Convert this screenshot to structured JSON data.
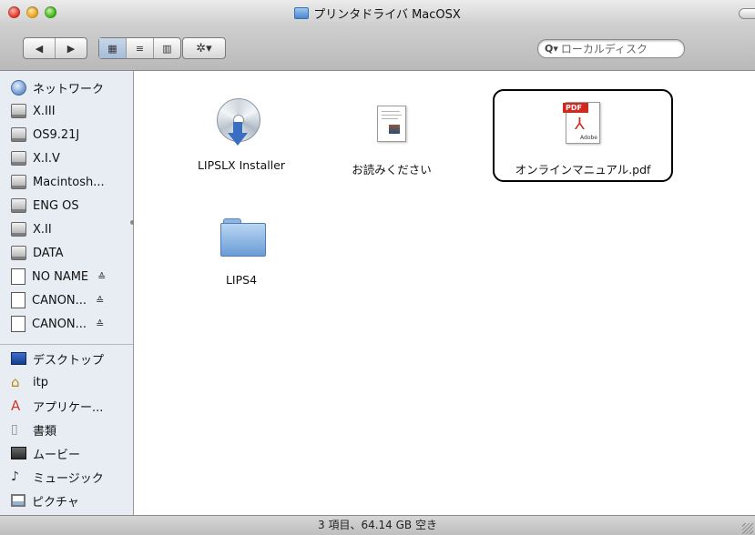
{
  "window": {
    "title": "プリンタドライバ MacOSX"
  },
  "toolbar": {
    "back_label": "◀",
    "forward_label": "▶",
    "view_icon_label": "▦",
    "view_list_label": "≡",
    "view_column_label": "▥",
    "action_label": "✲▾",
    "search_placeholder": "ローカルディスク"
  },
  "sidebar": {
    "devices": [
      {
        "label": "ネットワーク",
        "icon": "network-icon"
      },
      {
        "label": "X.III",
        "icon": "hard-disk-icon"
      },
      {
        "label": "OS9.21J",
        "icon": "hard-disk-icon"
      },
      {
        "label": "X.I.V",
        "icon": "hard-disk-icon"
      },
      {
        "label": "Macintosh...",
        "icon": "hard-disk-icon"
      },
      {
        "label": "ENG OS",
        "icon": "hard-disk-icon"
      },
      {
        "label": "X.II",
        "icon": "hard-disk-icon"
      },
      {
        "label": "DATA",
        "icon": "hard-disk-icon"
      },
      {
        "label": "NO NAME",
        "icon": "removable-disk-icon",
        "eject": "≙"
      },
      {
        "label": "CANON...",
        "icon": "removable-disk-icon",
        "eject": "≙"
      },
      {
        "label": "CANON...",
        "icon": "removable-disk-icon",
        "eject": "≙"
      }
    ],
    "places": [
      {
        "label": "デスクトップ",
        "icon": "desktop-icon"
      },
      {
        "label": "itp",
        "icon": "home-icon"
      },
      {
        "label": "アプリケー...",
        "icon": "applications-icon"
      },
      {
        "label": "書類",
        "icon": "documents-icon"
      },
      {
        "label": "ムービー",
        "icon": "movies-icon"
      },
      {
        "label": "ミュージック",
        "icon": "music-icon"
      },
      {
        "label": "ピクチャ",
        "icon": "pictures-icon"
      }
    ]
  },
  "files": [
    {
      "name": "LIPSLX Installer",
      "icon": "cd-installer-icon"
    },
    {
      "name": "お読みください",
      "icon": "readme-document-icon"
    },
    {
      "name": "オンラインマニュアル.pdf",
      "icon": "pdf-document-icon",
      "pdf_badge": "PDF",
      "adobe_mark": "Adobe"
    },
    {
      "name": "LIPS4",
      "icon": "folder-icon"
    }
  ],
  "status": {
    "text": "3 項目、64.14 GB 空き"
  }
}
